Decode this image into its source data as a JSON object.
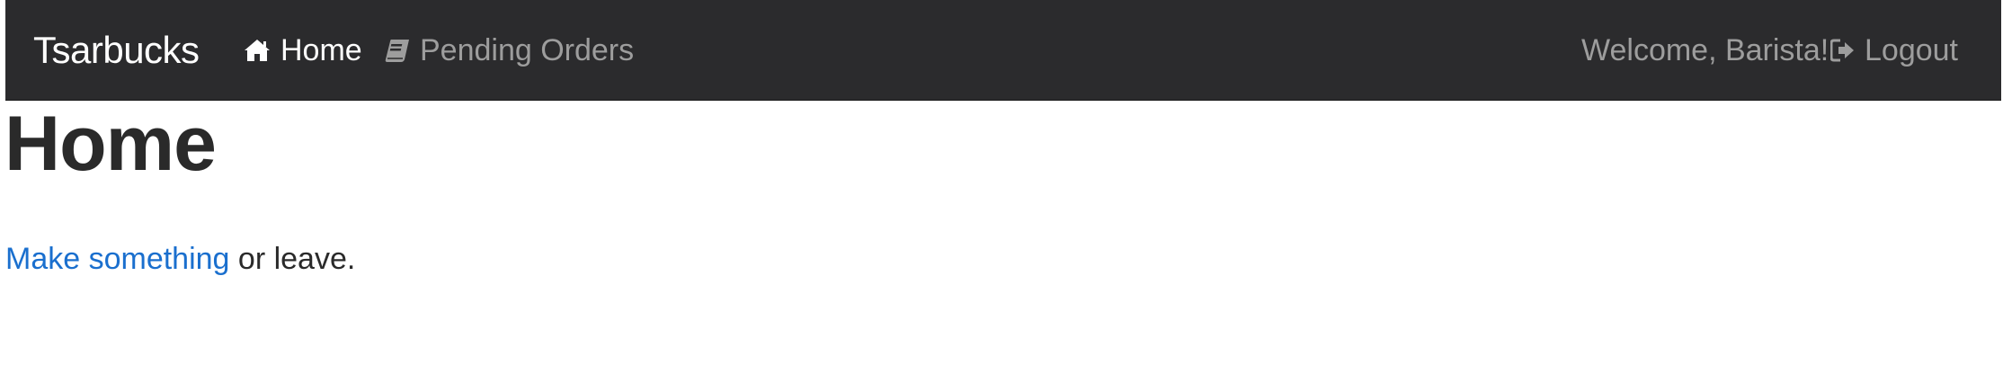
{
  "navbar": {
    "brand": "Tsarbucks",
    "links": [
      {
        "label": "Home",
        "icon": "home-icon",
        "active": true
      },
      {
        "label": "Pending Orders",
        "icon": "book-icon",
        "active": false
      }
    ],
    "welcome": "Welcome, Barista!",
    "logout": {
      "label": "Logout",
      "icon": "logout-icon"
    }
  },
  "main": {
    "title": "Home",
    "intro": {
      "link_text": "Make something",
      "trailing_text": " or leave."
    }
  },
  "colors": {
    "navbar_bg": "#2b2b2d",
    "nav_active": "#ffffff",
    "nav_muted": "#9d9d9d",
    "link": "#1a6fce",
    "text": "#2a2a2a"
  }
}
